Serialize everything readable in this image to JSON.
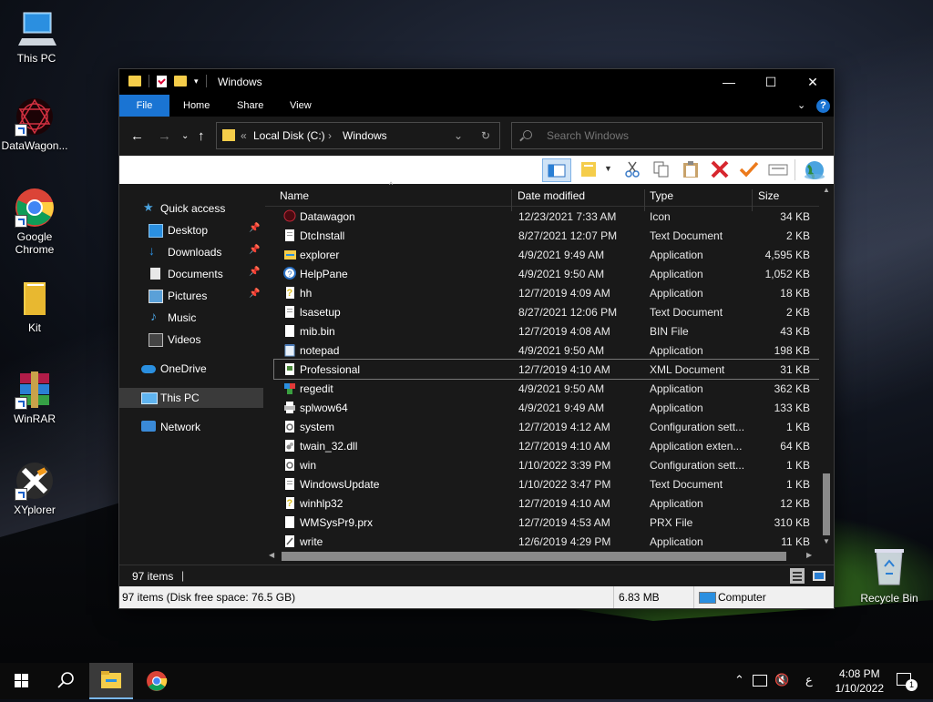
{
  "desktop": {
    "icons": [
      {
        "label": "This PC",
        "icon": "this-pc-icon"
      },
      {
        "label": "DataWagon...",
        "icon": "datawagon-icon"
      },
      {
        "label": "Google Chrome",
        "icon": "chrome-icon"
      },
      {
        "label": "Kit",
        "icon": "folder-icon"
      },
      {
        "label": "WinRAR",
        "icon": "winrar-icon"
      },
      {
        "label": "XYplorer",
        "icon": "xyplorer-icon"
      }
    ],
    "recycle_bin": "Recycle Bin"
  },
  "window": {
    "title": "Windows",
    "ribbon_tabs": [
      "File",
      "Home",
      "Share",
      "View"
    ],
    "address": {
      "prefix": "«",
      "crumbs": [
        "Local Disk (C:)",
        "Windows"
      ]
    },
    "search_placeholder": "Search Windows"
  },
  "nav": {
    "items": [
      {
        "label": "Quick access",
        "icon": "star-icon",
        "pinned": false
      },
      {
        "label": "Desktop",
        "icon": "desktop-icon",
        "pinned": true
      },
      {
        "label": "Downloads",
        "icon": "download-icon",
        "pinned": true
      },
      {
        "label": "Documents",
        "icon": "document-icon",
        "pinned": true
      },
      {
        "label": "Pictures",
        "icon": "pictures-icon",
        "pinned": true
      },
      {
        "label": "Music",
        "icon": "music-icon",
        "pinned": false
      },
      {
        "label": "Videos",
        "icon": "videos-icon",
        "pinned": false
      },
      {
        "label": "OneDrive",
        "icon": "cloud-icon",
        "pinned": false
      },
      {
        "label": "This PC",
        "icon": "this-pc-icon",
        "pinned": false,
        "selected": true
      },
      {
        "label": "Network",
        "icon": "network-icon",
        "pinned": false
      }
    ]
  },
  "columns": [
    "Name",
    "Date modified",
    "Type",
    "Size"
  ],
  "files": [
    {
      "name": "Datawagon",
      "date": "12/23/2021 7:33 AM",
      "type": "Icon",
      "size": "34 KB",
      "icon": "datawagon-icon"
    },
    {
      "name": "DtcInstall",
      "date": "8/27/2021 12:07 PM",
      "type": "Text Document",
      "size": "2 KB",
      "icon": "text-file-icon"
    },
    {
      "name": "explorer",
      "date": "4/9/2021 9:49 AM",
      "type": "Application",
      "size": "4,595 KB",
      "icon": "folder-app-icon"
    },
    {
      "name": "HelpPane",
      "date": "4/9/2021 9:50 AM",
      "type": "Application",
      "size": "1,052 KB",
      "icon": "help-icon"
    },
    {
      "name": "hh",
      "date": "12/7/2019 4:09 AM",
      "type": "Application",
      "size": "18 KB",
      "icon": "help-doc-icon"
    },
    {
      "name": "lsasetup",
      "date": "8/27/2021 12:06 PM",
      "type": "Text Document",
      "size": "2 KB",
      "icon": "text-file-icon"
    },
    {
      "name": "mib.bin",
      "date": "12/7/2019 4:08 AM",
      "type": "BIN File",
      "size": "43 KB",
      "icon": "blank-file-icon"
    },
    {
      "name": "notepad",
      "date": "4/9/2021 9:50 AM",
      "type": "Application",
      "size": "198 KB",
      "icon": "notepad-icon"
    },
    {
      "name": "Professional",
      "date": "12/7/2019 4:10 AM",
      "type": "XML Document",
      "size": "31 KB",
      "icon": "xml-file-icon",
      "focused": true
    },
    {
      "name": "regedit",
      "date": "4/9/2021 9:50 AM",
      "type": "Application",
      "size": "362 KB",
      "icon": "regedit-icon"
    },
    {
      "name": "splwow64",
      "date": "4/9/2021 9:49 AM",
      "type": "Application",
      "size": "133 KB",
      "icon": "printer-icon"
    },
    {
      "name": "system",
      "date": "12/7/2019 4:12 AM",
      "type": "Configuration sett...",
      "size": "1 KB",
      "icon": "config-file-icon"
    },
    {
      "name": "twain_32.dll",
      "date": "12/7/2019 4:10 AM",
      "type": "Application exten...",
      "size": "64 KB",
      "icon": "dll-file-icon"
    },
    {
      "name": "win",
      "date": "1/10/2022 3:39 PM",
      "type": "Configuration sett...",
      "size": "1 KB",
      "icon": "config-file-icon"
    },
    {
      "name": "WindowsUpdate",
      "date": "1/10/2022 3:47 PM",
      "type": "Text Document",
      "size": "1 KB",
      "icon": "text-file-icon"
    },
    {
      "name": "winhlp32",
      "date": "12/7/2019 4:10 AM",
      "type": "Application",
      "size": "12 KB",
      "icon": "help-doc-icon"
    },
    {
      "name": "WMSysPr9.prx",
      "date": "12/7/2019 4:53 AM",
      "type": "PRX File",
      "size": "310 KB",
      "icon": "blank-file-icon"
    },
    {
      "name": "write",
      "date": "12/6/2019 4:29 PM",
      "type": "Application",
      "size": "11 KB",
      "icon": "write-icon"
    }
  ],
  "status": {
    "count": "97 items",
    "summary": "97 items (Disk free space: 76.5 GB)",
    "size": "6.83 MB",
    "location": "Computer"
  },
  "taskbar": {
    "time": "4:08 PM",
    "date": "1/10/2022",
    "ime": "ع",
    "notification_count": "1"
  },
  "colors": {
    "accent": "#1a74d3",
    "window_bg": "#191919",
    "titlebar": "#000000"
  }
}
